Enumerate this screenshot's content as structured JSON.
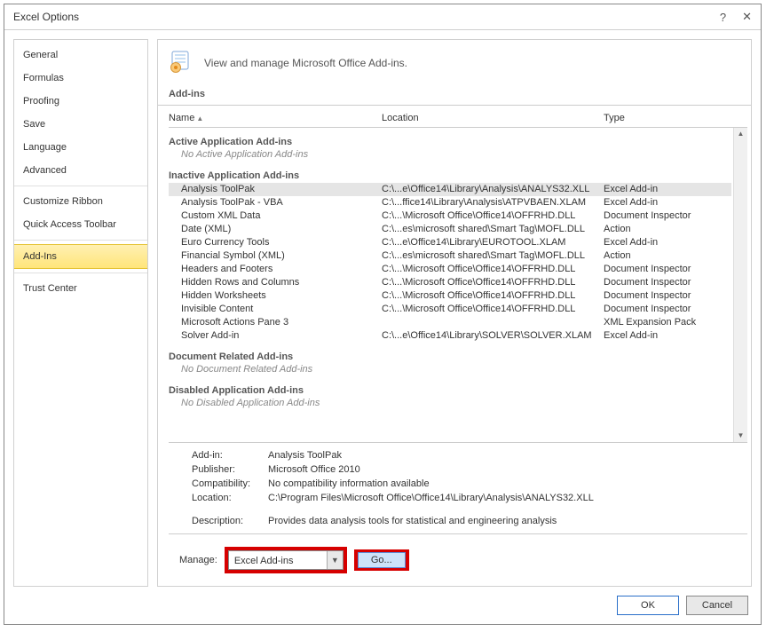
{
  "title": "Excel Options",
  "sidebar": {
    "groups": [
      [
        "General",
        "Formulas",
        "Proofing",
        "Save",
        "Language",
        "Advanced"
      ],
      [
        "Customize Ribbon",
        "Quick Access Toolbar"
      ],
      [
        "Add-Ins"
      ],
      [
        "Trust Center"
      ]
    ],
    "selected": "Add-Ins"
  },
  "header_text": "View and manage Microsoft Office Add-ins.",
  "section_title": "Add-ins",
  "columns": {
    "name": "Name",
    "location": "Location",
    "type": "Type"
  },
  "groups": {
    "active": {
      "title": "Active Application Add-ins",
      "empty": "No Active Application Add-ins"
    },
    "inactive": {
      "title": "Inactive Application Add-ins"
    },
    "docrel": {
      "title": "Document Related Add-ins",
      "empty": "No Document Related Add-ins"
    },
    "disabled": {
      "title": "Disabled Application Add-ins",
      "empty": "No Disabled Application Add-ins"
    }
  },
  "inactive_rows": [
    {
      "name": "Analysis ToolPak",
      "location": "C:\\...e\\Office14\\Library\\Analysis\\ANALYS32.XLL",
      "type": "Excel Add-in",
      "selected": true
    },
    {
      "name": "Analysis ToolPak - VBA",
      "location": "C:\\...ffice14\\Library\\Analysis\\ATPVBAEN.XLAM",
      "type": "Excel Add-in"
    },
    {
      "name": "Custom XML Data",
      "location": "C:\\...\\Microsoft Office\\Office14\\OFFRHD.DLL",
      "type": "Document Inspector"
    },
    {
      "name": "Date (XML)",
      "location": "C:\\...es\\microsoft shared\\Smart Tag\\MOFL.DLL",
      "type": "Action"
    },
    {
      "name": "Euro Currency Tools",
      "location": "C:\\...e\\Office14\\Library\\EUROTOOL.XLAM",
      "type": "Excel Add-in"
    },
    {
      "name": "Financial Symbol (XML)",
      "location": "C:\\...es\\microsoft shared\\Smart Tag\\MOFL.DLL",
      "type": "Action"
    },
    {
      "name": "Headers and Footers",
      "location": "C:\\...\\Microsoft Office\\Office14\\OFFRHD.DLL",
      "type": "Document Inspector"
    },
    {
      "name": "Hidden Rows and Columns",
      "location": "C:\\...\\Microsoft Office\\Office14\\OFFRHD.DLL",
      "type": "Document Inspector"
    },
    {
      "name": "Hidden Worksheets",
      "location": "C:\\...\\Microsoft Office\\Office14\\OFFRHD.DLL",
      "type": "Document Inspector"
    },
    {
      "name": "Invisible Content",
      "location": "C:\\...\\Microsoft Office\\Office14\\OFFRHD.DLL",
      "type": "Document Inspector"
    },
    {
      "name": "Microsoft Actions Pane 3",
      "location": "",
      "type": "XML Expansion Pack"
    },
    {
      "name": "Solver Add-in",
      "location": "C:\\...e\\Office14\\Library\\SOLVER\\SOLVER.XLAM",
      "type": "Excel Add-in"
    }
  ],
  "details": {
    "labels": {
      "addin": "Add-in:",
      "publisher": "Publisher:",
      "compat": "Compatibility:",
      "location": "Location:",
      "desc": "Description:"
    },
    "addin": "Analysis ToolPak",
    "publisher": "Microsoft Office 2010",
    "compat": "No compatibility information available",
    "location": "C:\\Program Files\\Microsoft Office\\Office14\\Library\\Analysis\\ANALYS32.XLL",
    "desc": "Provides data analysis tools for statistical and engineering analysis"
  },
  "manage": {
    "label": "Manage:",
    "selected": "Excel Add-ins",
    "go": "Go..."
  },
  "footer": {
    "ok": "OK",
    "cancel": "Cancel"
  }
}
